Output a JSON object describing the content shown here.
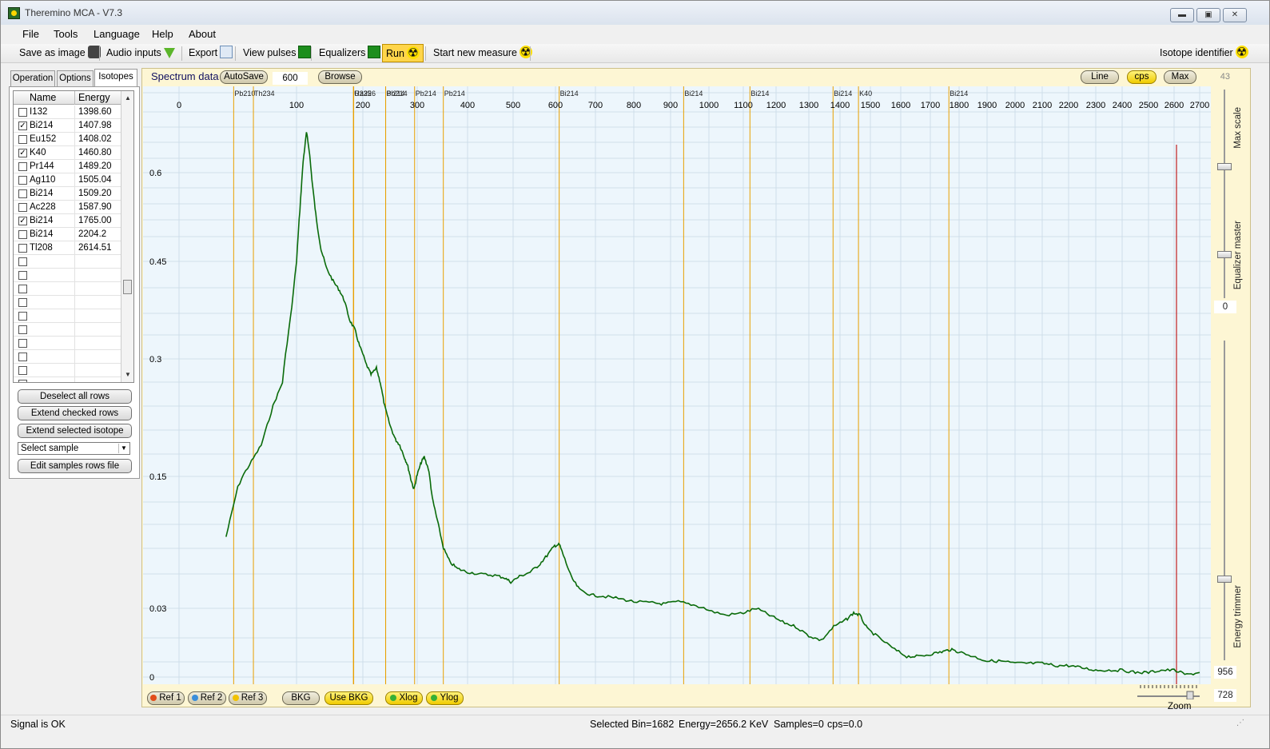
{
  "window": {
    "title": "Theremino MCA - V7.3",
    "buttons": {
      "minimize": "▬",
      "maximize": "▣",
      "close": "✕"
    }
  },
  "menu": [
    "File",
    "Tools",
    "Language",
    "Help",
    "About"
  ],
  "toolbar": {
    "save_image": "Save as image",
    "audio_inputs": "Audio inputs",
    "export": "Export",
    "view_pulses": "View pulses",
    "equalizers": "Equalizers",
    "run": "Run",
    "start_new_measure": "Start new measure",
    "isotope_identifier": "Isotope identifier"
  },
  "left_panel": {
    "tabs": [
      "Operation",
      "Options",
      "Isotopes"
    ],
    "selected_tab": "Isotopes",
    "columns": [
      "Name",
      "Energy"
    ],
    "rows": [
      {
        "checked": false,
        "name": "I132",
        "energy": "1398.60"
      },
      {
        "checked": true,
        "name": "Bi214",
        "energy": "1407.98"
      },
      {
        "checked": false,
        "name": "Eu152",
        "energy": "1408.02"
      },
      {
        "checked": true,
        "name": "K40",
        "energy": "1460.80"
      },
      {
        "checked": false,
        "name": "Pr144",
        "energy": "1489.20"
      },
      {
        "checked": false,
        "name": "Ag110",
        "energy": "1505.04"
      },
      {
        "checked": false,
        "name": "Bi214",
        "energy": "1509.20"
      },
      {
        "checked": false,
        "name": "Ac228",
        "energy": "1587.90"
      },
      {
        "checked": true,
        "name": "Bi214",
        "energy": "1765.00"
      },
      {
        "checked": false,
        "name": "Bi214",
        "energy": "2204.2"
      },
      {
        "checked": false,
        "name": "Tl208",
        "energy": "2614.51"
      },
      {
        "checked": false,
        "name": "",
        "energy": ""
      },
      {
        "checked": false,
        "name": "",
        "energy": ""
      },
      {
        "checked": false,
        "name": "",
        "energy": ""
      },
      {
        "checked": false,
        "name": "",
        "energy": ""
      },
      {
        "checked": false,
        "name": "",
        "energy": ""
      },
      {
        "checked": false,
        "name": "",
        "energy": ""
      },
      {
        "checked": false,
        "name": "",
        "energy": ""
      },
      {
        "checked": false,
        "name": "",
        "energy": ""
      },
      {
        "checked": false,
        "name": "",
        "energy": ""
      },
      {
        "checked": false,
        "name": "",
        "energy": ""
      }
    ],
    "buttons": {
      "deselect_all": "Deselect all rows",
      "extend_checked": "Extend checked rows",
      "extend_selected": "Extend selected isotope",
      "edit_samples": "Edit samples rows file"
    },
    "select_sample": "Select sample"
  },
  "spectrum": {
    "title": "Spectrum data",
    "autosave": "AutoSave",
    "autosave_value": "600",
    "browse": "Browse",
    "line_btn": "Line",
    "cps_btn": "cps",
    "max_btn": "Max",
    "max_value": "43",
    "energy_ticks": [
      "0",
      "100",
      "200",
      "300",
      "400",
      "500",
      "600",
      "700",
      "800",
      "900",
      "1000",
      "1100",
      "1200",
      "1300",
      "1400",
      "1500",
      "1600",
      "1700",
      "1800",
      "1900",
      "2000",
      "2100",
      "2200",
      "2300",
      "2400",
      "2500",
      "2600",
      "2700"
    ],
    "y_ticks": [
      "0",
      "0.03",
      "0.15",
      "0.3",
      "0.45",
      "0.6"
    ],
    "isotope_markers": [
      "Pb210",
      "Th234",
      "U235",
      "Ra226",
      "Bi214",
      "Pb214",
      "Pb214",
      "Pb214",
      "Bi214",
      "Bi214",
      "Bi214",
      "Bi214",
      "K40",
      "Bi214"
    ],
    "colors": {
      "spectrum_line": "#0a6b0a",
      "marker_line": "#e8a000",
      "cursor_line": "#c02020",
      "background": "#edf6fc"
    }
  },
  "right_panel": {
    "max_scale_label": "Max scale",
    "equalizer_master_label": "Equalizer master",
    "equalizer_value": "0",
    "energy_trimmer_label": "Energy trimmer",
    "energy_trimmer_value": "956",
    "zoom_value": "728",
    "zoom_label": "Zoom"
  },
  "bottom_bar": {
    "ref1": "Ref 1",
    "ref2": "Ref 2",
    "ref3": "Ref 3",
    "bkg": "BKG",
    "use_bkg": "Use BKG",
    "xlog": "Xlog",
    "ylog": "Ylog"
  },
  "status": {
    "signal": "Signal is OK",
    "selected_bin": "Selected Bin=1682",
    "energy": "Energy=2656.2 KeV",
    "samples": "Samples=0",
    "cps": "cps=0.0"
  }
}
